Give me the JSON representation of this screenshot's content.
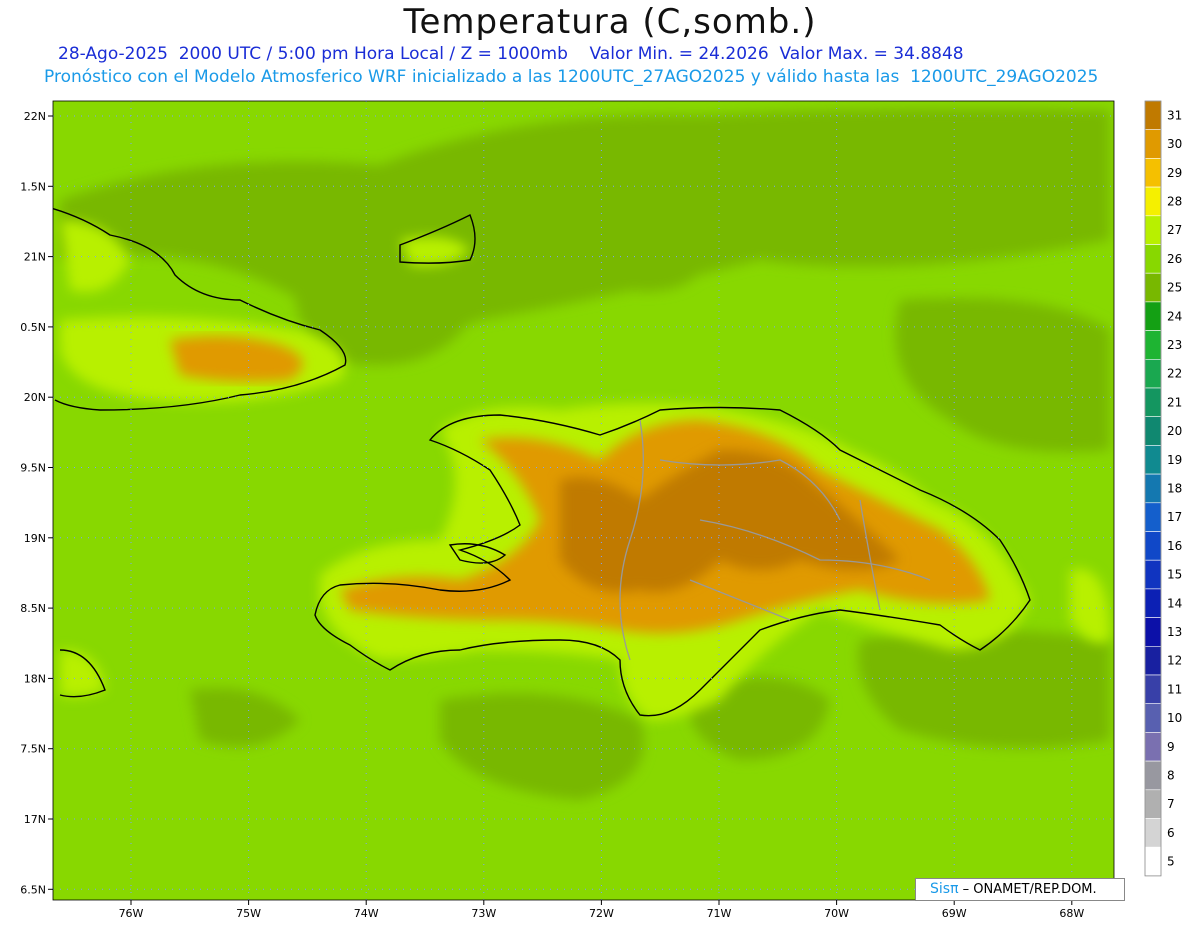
{
  "header": {
    "title": "Temperatura (C,somb.)",
    "line1": "28-Ago-2025  2000 UTC / 5:00 pm Hora Local / Z = 1000mb    Valor Min. = 24.2026  Valor Max. = 34.8848",
    "line2": "Pronóstico con el Modelo Atmosferico WRF inicializado a las 1200UTC_27AGO2025 y válido hasta las  1200UTC_29AGO2025"
  },
  "axes": {
    "lat_labels": [
      "22N",
      "1.5N",
      "21N",
      "0.5N",
      "20N",
      "9.5N",
      "19N",
      "8.5N",
      "18N",
      "7.5N",
      "17N",
      "6.5N"
    ],
    "lon_labels": [
      "76W",
      "75W",
      "74W",
      "73W",
      "72W",
      "71W",
      "70W",
      "69W",
      "68W"
    ]
  },
  "colorbar": {
    "labels": [
      "31",
      "30",
      "29",
      "28",
      "27",
      "26",
      "25",
      "24",
      "23",
      "22",
      "21",
      "20",
      "19",
      "18",
      "17",
      "16",
      "15",
      "14",
      "13",
      "12",
      "11",
      "10",
      "9",
      "8",
      "7",
      "6",
      "5"
    ],
    "colors": [
      "#c07a00",
      "#e09a00",
      "#f5c000",
      "#f5f000",
      "#b8f000",
      "#88d800",
      "#78b800",
      "#14a014",
      "#1eb432",
      "#1aa850",
      "#149660",
      "#108870",
      "#108a90",
      "#1478b0",
      "#145fcc",
      "#1048c8",
      "#1034c0",
      "#0c20b4",
      "#0c10a8",
      "#1820a0",
      "#3840a8",
      "#5860b0",
      "#7a70b0",
      "#9898a0",
      "#b0b0b0",
      "#d4d4d4",
      "#ffffff"
    ]
  },
  "map": {
    "sea_color": "#88d800",
    "land_color": "#e09a00",
    "credit": {
      "brand": "Sisπ",
      "text": "– ONAMET/REP.DOM."
    }
  }
}
